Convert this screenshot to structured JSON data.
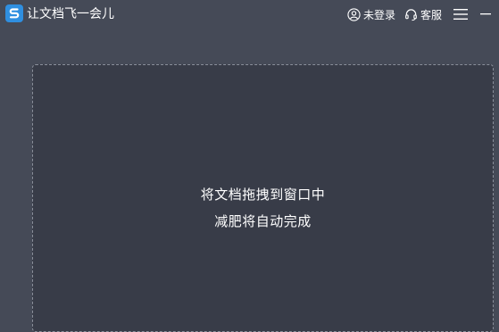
{
  "app": {
    "title": "让文档飞一会儿",
    "logo_icon": "app-logo-icon",
    "accent": "#2f8fe0"
  },
  "header": {
    "login_label": "未登录",
    "login_icon": "user-icon",
    "service_label": "客服",
    "service_icon": "headset-icon",
    "menu_icon": "hamburger-menu-icon",
    "minimize_icon": "minimize-icon"
  },
  "drop_zone": {
    "line1": "将文档拖拽到窗口中",
    "line2": "减肥将自动完成"
  },
  "colors": {
    "background": "#454a57",
    "drop_zone_bg": "#383c48",
    "dash_border": "#8a8f9a"
  }
}
